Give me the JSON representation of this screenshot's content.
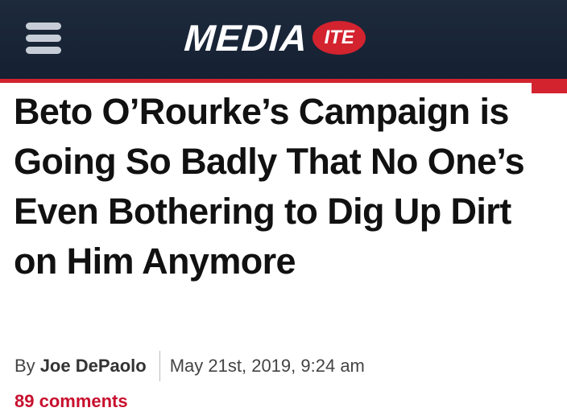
{
  "header": {
    "logo_text": "MEDIA",
    "logo_badge": "ITE",
    "menu_icon": "hamburger-menu-icon",
    "background_color": "#1d2a3c",
    "accent_color": "#d3232f"
  },
  "article": {
    "headline": "Beto O’Rourke’s Campaign is Going So Badly That No One’s Even Bothering to Dig Up Dirt on Him Anymore",
    "byline_prefix": "By",
    "author": "Joe DePaolo",
    "date": "May 21st, 2019, 9:24 am",
    "comments": "89 comments",
    "comments_color": "#c8102e"
  }
}
